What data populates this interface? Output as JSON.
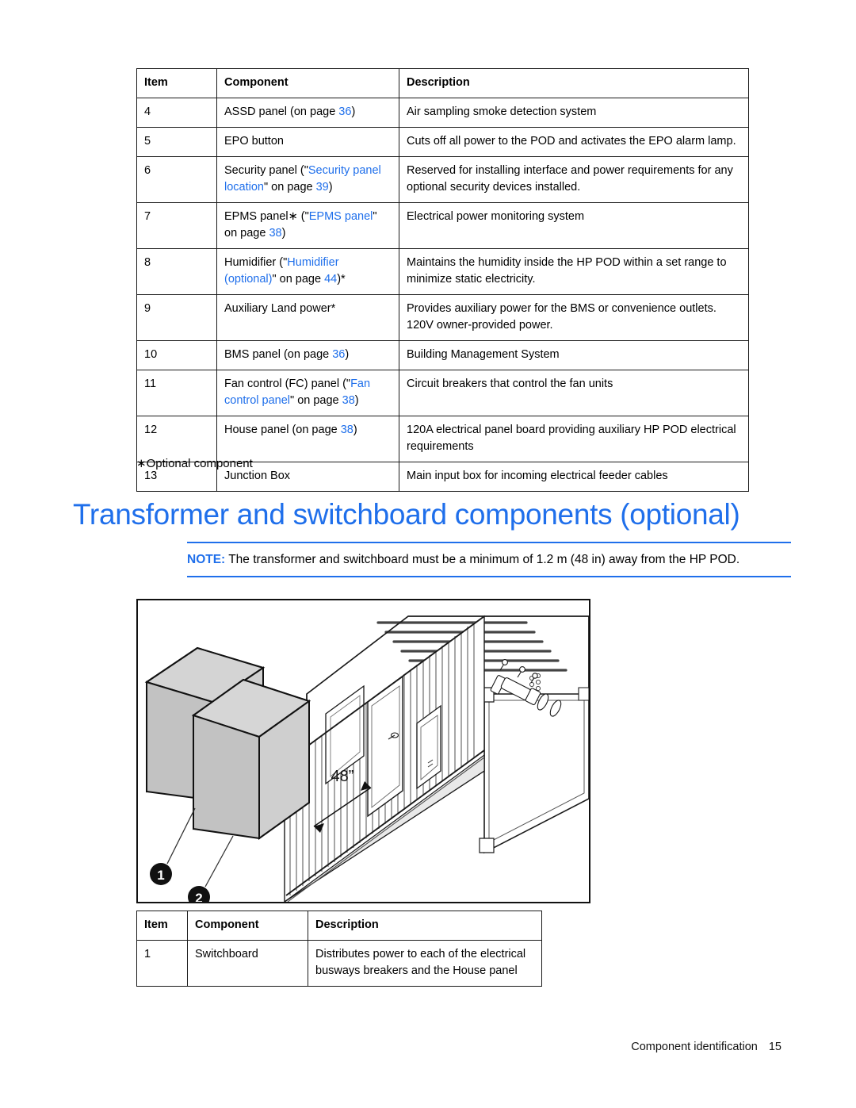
{
  "components_table": {
    "headers": [
      "Item",
      "Component",
      "Description"
    ],
    "rows": [
      {
        "item": "4",
        "component_parts": [
          {
            "text": "ASSD panel (on page ",
            "link": false
          },
          {
            "text": "36",
            "link": true
          },
          {
            "text": ")",
            "link": false
          }
        ],
        "description": "Air sampling smoke detection system"
      },
      {
        "item": "5",
        "component_parts": [
          {
            "text": "EPO button",
            "link": false
          }
        ],
        "description": "Cuts off all power to the POD and activates the EPO alarm lamp."
      },
      {
        "item": "6",
        "component_parts": [
          {
            "text": "Security panel (\"",
            "link": false
          },
          {
            "text": "Security panel location",
            "link": true
          },
          {
            "text": "\" on page ",
            "link": false
          },
          {
            "text": "39",
            "link": true
          },
          {
            "text": ")",
            "link": false
          }
        ],
        "description": "Reserved for installing interface and power requirements for any optional security devices installed."
      },
      {
        "item": "7",
        "component_parts": [
          {
            "text": "EPMS panel∗ (\"",
            "link": false
          },
          {
            "text": "EPMS panel",
            "link": true
          },
          {
            "text": "\" on page ",
            "link": false
          },
          {
            "text": "38",
            "link": true
          },
          {
            "text": ")",
            "link": false
          }
        ],
        "description": "Electrical power monitoring system"
      },
      {
        "item": "8",
        "component_parts": [
          {
            "text": "Humidifier (\"",
            "link": false
          },
          {
            "text": "Humidifier (optional)",
            "link": true
          },
          {
            "text": "\" on page ",
            "link": false
          },
          {
            "text": "44",
            "link": true
          },
          {
            "text": ")*",
            "link": false
          }
        ],
        "description": "Maintains the humidity inside the HP POD within a set range to minimize static electricity."
      },
      {
        "item": "9",
        "component_parts": [
          {
            "text": "Auxiliary Land power*",
            "link": false
          }
        ],
        "description": "Provides auxiliary power for the BMS or convenience outlets. 120V owner-provided power."
      },
      {
        "item": "10",
        "component_parts": [
          {
            "text": "BMS panel (on page ",
            "link": false
          },
          {
            "text": "36",
            "link": true
          },
          {
            "text": ")",
            "link": false
          }
        ],
        "description": "Building Management System"
      },
      {
        "item": "11",
        "component_parts": [
          {
            "text": "Fan control (FC) panel (\"",
            "link": false
          },
          {
            "text": "Fan control panel",
            "link": true
          },
          {
            "text": "\" on page ",
            "link": false
          },
          {
            "text": "38",
            "link": true
          },
          {
            "text": ")",
            "link": false
          }
        ],
        "description": "Circuit breakers that control the fan units"
      },
      {
        "item": "12",
        "component_parts": [
          {
            "text": "House panel (on page ",
            "link": false
          },
          {
            "text": "38",
            "link": true
          },
          {
            "text": ")",
            "link": false
          }
        ],
        "description": "120A electrical panel board providing auxiliary HP POD electrical requirements"
      },
      {
        "item": "13",
        "component_parts": [
          {
            "text": "Junction Box",
            "link": false
          }
        ],
        "description": "Main input box for incoming electrical feeder cables"
      }
    ]
  },
  "optional_footnote": "∗Optional component",
  "heading": "Transformer and switchboard components (optional)",
  "note": {
    "label": "NOTE:",
    "text": "The transformer and switchboard must be a minimum of 1.2 m (48 in) away from the HP POD."
  },
  "illustration": {
    "dimension_label": "48”",
    "callouts": [
      "1",
      "2"
    ]
  },
  "switchboard_table": {
    "headers": [
      "Item",
      "Component",
      "Description"
    ],
    "rows": [
      {
        "item": "1",
        "component": "Switchboard",
        "description": "Distributes power to each of the electrical busways breakers and the House panel"
      }
    ]
  },
  "footer": {
    "section": "Component identification",
    "page_number": "15"
  },
  "colors": {
    "link": "#1f6feb",
    "heading": "#1f6feb",
    "note_rule": "#1f6feb",
    "table_border": "#1a1a1a",
    "text": "#000000",
    "illustration_fill": "#c9c9c9"
  }
}
